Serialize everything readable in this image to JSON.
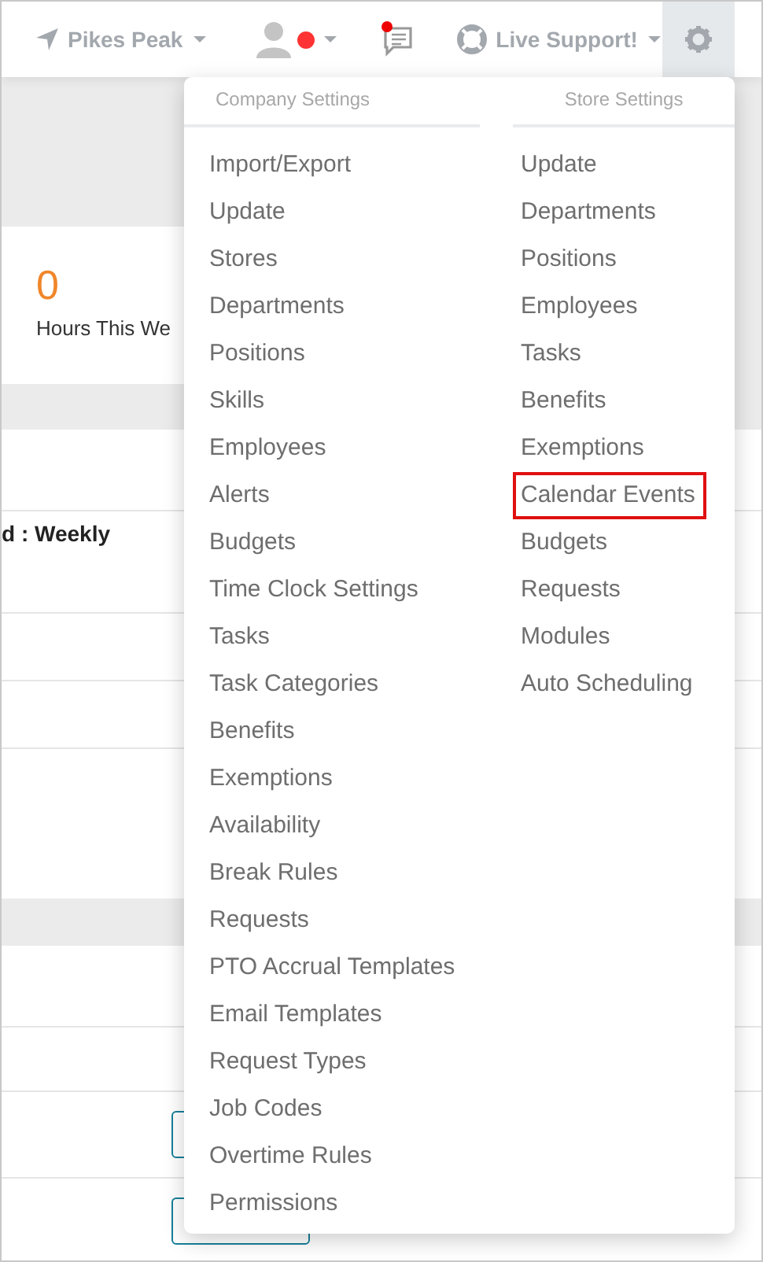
{
  "nav": {
    "location": "Pikes Peak",
    "user": {
      "alert": true
    },
    "messages": {
      "unread": true
    },
    "support": "Live Support!",
    "settings": {
      "open": true
    }
  },
  "summary": {
    "value": "0",
    "label": "Hours This We"
  },
  "schedule": {
    "period": "d : Weekly"
  },
  "settings_menu": {
    "columns": [
      {
        "heading": "Company Settings",
        "items": [
          {
            "label": "Import/Export",
            "highlighted": false
          },
          {
            "label": "Update",
            "highlighted": false
          },
          {
            "label": "Stores",
            "highlighted": false
          },
          {
            "label": "Departments",
            "highlighted": false
          },
          {
            "label": "Positions",
            "highlighted": false
          },
          {
            "label": "Skills",
            "highlighted": false
          },
          {
            "label": "Employees",
            "highlighted": false
          },
          {
            "label": "Alerts",
            "highlighted": false
          },
          {
            "label": "Budgets",
            "highlighted": false
          },
          {
            "label": "Time Clock Settings",
            "highlighted": false
          },
          {
            "label": "Tasks",
            "highlighted": false
          },
          {
            "label": "Task Categories",
            "highlighted": false
          },
          {
            "label": "Benefits",
            "highlighted": false
          },
          {
            "label": "Exemptions",
            "highlighted": false
          },
          {
            "label": "Availability",
            "highlighted": false
          },
          {
            "label": "Break Rules",
            "highlighted": false
          },
          {
            "label": "Requests",
            "highlighted": false
          },
          {
            "label": "PTO Accrual Templates",
            "highlighted": false
          },
          {
            "label": "Email Templates",
            "highlighted": false
          },
          {
            "label": "Request Types",
            "highlighted": false
          },
          {
            "label": "Job Codes",
            "highlighted": false
          },
          {
            "label": "Overtime Rules",
            "highlighted": false
          },
          {
            "label": "Permissions",
            "highlighted": false
          }
        ]
      },
      {
        "heading": "Store Settings",
        "items": [
          {
            "label": "Update",
            "highlighted": false
          },
          {
            "label": "Departments",
            "highlighted": false
          },
          {
            "label": "Positions",
            "highlighted": false
          },
          {
            "label": "Employees",
            "highlighted": false
          },
          {
            "label": "Tasks",
            "highlighted": false
          },
          {
            "label": "Benefits",
            "highlighted": false
          },
          {
            "label": "Exemptions",
            "highlighted": false
          },
          {
            "label": "Calendar Events",
            "highlighted": true
          },
          {
            "label": "Budgets",
            "highlighted": false
          },
          {
            "label": "Requests",
            "highlighted": false
          },
          {
            "label": "Modules",
            "highlighted": false
          },
          {
            "label": "Auto Scheduling",
            "highlighted": false
          }
        ]
      }
    ]
  }
}
